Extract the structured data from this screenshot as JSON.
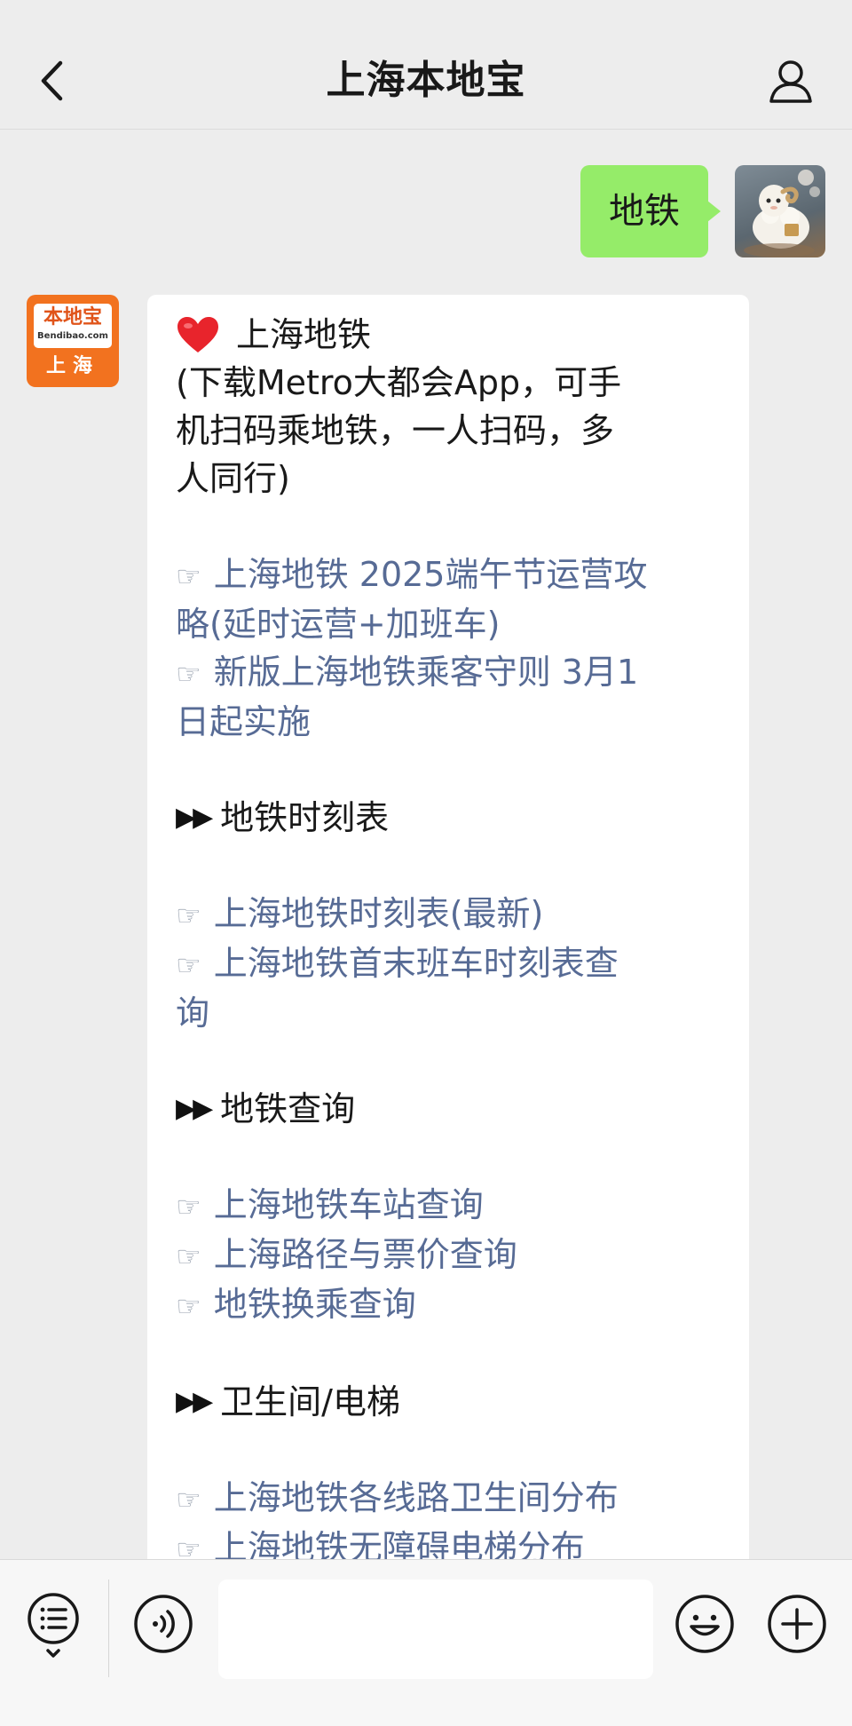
{
  "header": {
    "title": "上海本地宝",
    "back_icon": "chevron-left-icon",
    "profile_icon": "person-icon"
  },
  "sent_message": {
    "text": "地铁",
    "bubble_color": "#95ec69"
  },
  "bot": {
    "avatar_logo_cn": "本地宝",
    "avatar_logo_en": "Bendibao.com",
    "avatar_city": "上海",
    "brand_color": "#f2721f"
  },
  "reply": {
    "heading": "上海地铁",
    "intro_lines": [
      "(下载Metro大都会App，可手",
      "机扫码乘地铁，一人扫码，多",
      "人同行)"
    ],
    "hand_symbol": "☞",
    "arrow_symbol": "▶▶",
    "group1_links": [
      {
        "lines": [
          "上海地铁 2025端午节运营攻",
          "略(延时运营+加班车)"
        ]
      },
      {
        "lines": [
          "新版上海地铁乘客守则 3月1",
          "日起实施"
        ]
      }
    ],
    "section_timetable": "地铁时刻表",
    "timetable_links": [
      {
        "lines": [
          "上海地铁时刻表(最新)"
        ]
      },
      {
        "lines": [
          "上海地铁首末班车时刻表查",
          "询"
        ]
      }
    ],
    "section_query": "地铁查询",
    "query_links": [
      {
        "lines": [
          "上海地铁车站查询"
        ]
      },
      {
        "lines": [
          "上海路径与票价查询"
        ]
      },
      {
        "lines": [
          "地铁换乘查询"
        ]
      }
    ],
    "section_facilities": "卫生间/电梯",
    "facility_links": [
      {
        "lines": [
          "上海地铁各线路卫生间分布"
        ]
      },
      {
        "lines": [
          "上海地铁无障碍电梯分布"
        ]
      }
    ],
    "link_color": "#576b95"
  },
  "input_bar": {
    "menu_icon": "menu-list-icon",
    "voice_icon": "voice-icon",
    "input_value": "",
    "emoji_icon": "emoji-icon",
    "plus_icon": "plus-circle-icon"
  }
}
